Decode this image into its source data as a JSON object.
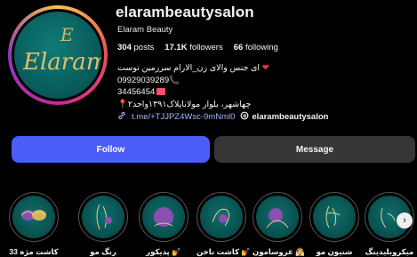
{
  "profile": {
    "username": "elarambeautysalon",
    "full_name": "Elaram Beauty",
    "logo_text": "Elaram",
    "logo_monogram": "E",
    "posts_count": "304",
    "posts_label": "posts",
    "followers_count": "17.1K",
    "followers_label": "followers",
    "following_count": "66",
    "following_label": "following"
  },
  "bio": {
    "line1": "ای جنس والای زن_الارام سرزمین توست",
    "line2": "09929039289",
    "line3": "34456454",
    "line4": "چهاشهر، بلوار مولانا‌پلاک۱۳۹۱واحد۲",
    "link": "t.me/+TJJPZ4Wsc-9mNml0",
    "threads_handle": "elarambeautysalon"
  },
  "actions": {
    "follow_label": "Follow",
    "message_label": "Message"
  },
  "highlights": [
    {
      "label": "کاشت مژه 33"
    },
    {
      "label": "رنگ مو"
    },
    {
      "label": "پدیکور 💅"
    },
    {
      "label": "کاشت ناخن 💅"
    },
    {
      "label": "عروسامون 👰"
    },
    {
      "label": "شنیون مو"
    },
    {
      "label": "میکروبلیدینگ"
    }
  ],
  "colors": {
    "follow_button": "#4a5df9",
    "message_button": "#363636",
    "link": "#a3b6ff",
    "avatar_teal": "#0a5f5e",
    "gold": "#d8b45a"
  }
}
